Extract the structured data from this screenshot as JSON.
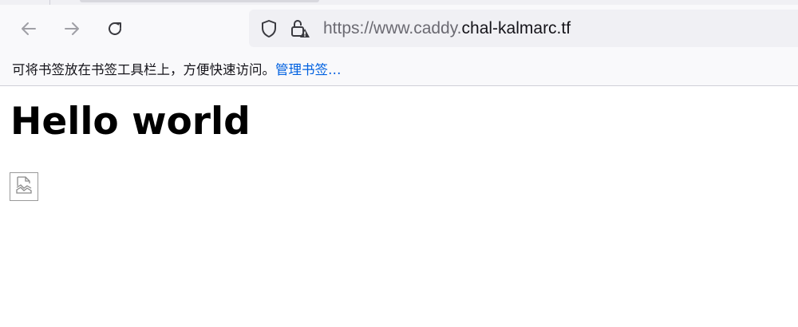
{
  "browser": {
    "url_prefix": "https://www.caddy.",
    "url_domain": "chal-kalmarc.tf",
    "icons": {
      "back": "back-arrow-icon",
      "forward": "forward-arrow-icon",
      "reload": "reload-icon",
      "tracking_protection": "shield-icon",
      "site_security": "lock-warning-icon"
    }
  },
  "bookmarks_bar": {
    "message": "可将书签放在书签工具栏上，方便快速访问。",
    "manage_link": "管理书签…"
  },
  "page": {
    "heading": "Hello world",
    "image_icon": "broken-image-icon"
  },
  "colors": {
    "link": "#0061e0",
    "toolbar_bg": "#f9f9fb",
    "urlbar_bg": "#f0f0f4"
  }
}
